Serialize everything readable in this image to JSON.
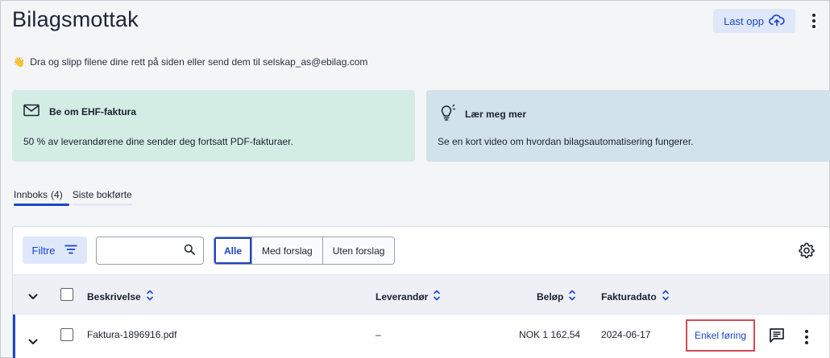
{
  "header": {
    "title": "Bilagsmottak",
    "upload_label": "Last opp",
    "upload_icon": "cloud-upload-icon",
    "more_icon": "kebab-menu-icon"
  },
  "hint": {
    "emoji": "👋",
    "text": "Dra og slipp filene dine rett på siden eller send dem til  selskap_as@ebilag.com"
  },
  "cards": [
    {
      "icon": "mail-icon",
      "title": "Be om EHF-faktura",
      "body": "50 % av leverandørene dine sender deg fortsatt PDF-fakturaer."
    },
    {
      "icon": "lightbulb-icon",
      "title": "Lær meg mer",
      "body": "Se en kort video om hvordan bilagsautomatisering fungerer."
    }
  ],
  "tabs": [
    {
      "label": "Innboks",
      "count": "(4)",
      "active": true
    },
    {
      "label": "Siste bokførte",
      "active": false
    }
  ],
  "toolbar": {
    "filter_label": "Filtre",
    "search_value": "",
    "segments": [
      "Alle",
      "Med forslag",
      "Uten forslag"
    ],
    "selected_segment": "Alle"
  },
  "table": {
    "columns": [
      "Beskrivelse",
      "Leverandør",
      "Beløp",
      "Fakturadato"
    ],
    "rows": [
      {
        "description": "Faktura-1896916.pdf",
        "supplier": "–",
        "amount": "NOK 1 162,54",
        "date": "2024-06-17",
        "action": "Enkel føring"
      }
    ]
  },
  "colors": {
    "accent": "#1d46c4",
    "green_card": "#d3ece4",
    "blue_card": "#d2e2ea",
    "highlight": "#d34a55"
  }
}
